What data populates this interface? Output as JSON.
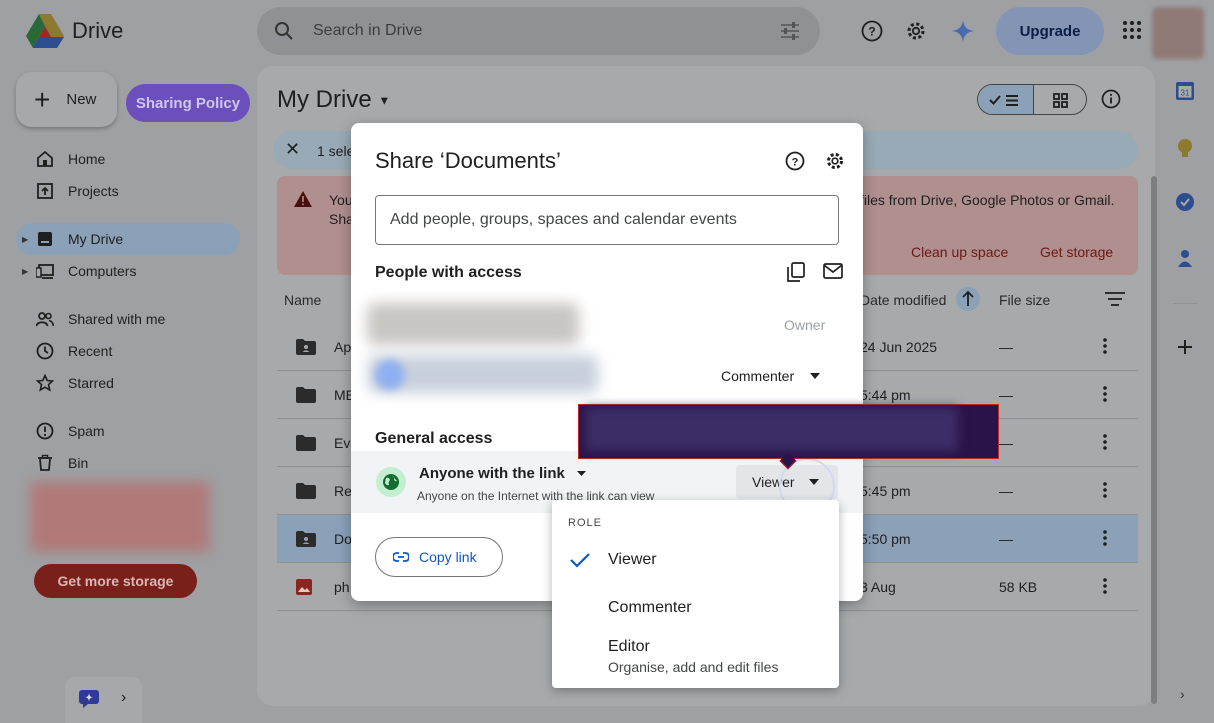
{
  "app": {
    "name": "Drive",
    "upgrade_label": "Upgrade"
  },
  "search": {
    "placeholder": "Search in Drive"
  },
  "sidebar": {
    "new_label": "New",
    "policy_label": "Sharing Policy",
    "items": [
      {
        "label": "Home",
        "icon": "home-icon"
      },
      {
        "label": "Projects",
        "icon": "projects-icon"
      },
      {
        "label": "My Drive",
        "icon": "my-drive-icon"
      },
      {
        "label": "Computers",
        "icon": "computers-icon"
      },
      {
        "label": "Shared with me",
        "icon": "people-icon"
      },
      {
        "label": "Recent",
        "icon": "clock-icon"
      },
      {
        "label": "Starred",
        "icon": "star-icon"
      },
      {
        "label": "Spam",
        "icon": "spam-icon"
      },
      {
        "label": "Bin",
        "icon": "bin-icon"
      }
    ],
    "more_storage_label": "Get more storage"
  },
  "main": {
    "title": "My Drive",
    "selection_text": "1 sele",
    "banner": {
      "line1": "You",
      "line2": "Sha",
      "line3": "files from Drive, Google Photos or Gmail.",
      "cleanup_label": "Clean up space",
      "storage_label": "Get storage"
    },
    "columns": {
      "name": "Name",
      "date": "Date modified",
      "size": "File size"
    },
    "rows": [
      {
        "name": "Ap",
        "date": "24 Jun 2025",
        "size": "—",
        "kind": "shared-folder"
      },
      {
        "name": "ME",
        "date": "5:44 pm",
        "size": "—",
        "kind": "folder"
      },
      {
        "name": "Eva",
        "date": "",
        "size": "—",
        "kind": "folder"
      },
      {
        "name": "Re",
        "date": "5:45 pm",
        "size": "—",
        "kind": "folder"
      },
      {
        "name": "Do",
        "date": "5:50 pm",
        "size": "—",
        "kind": "shared-folder",
        "selected": true
      },
      {
        "name": "ph",
        "date": "3 Aug",
        "size": "58 KB",
        "kind": "image"
      }
    ]
  },
  "dialog": {
    "title": "Share ‘Documents’",
    "add_placeholder": "Add people, groups, spaces and calendar events",
    "people_title": "People with access",
    "owner_label": "Owner",
    "commenter_label": "Commenter",
    "general_title": "General access",
    "link_scope": "Anyone with the link",
    "link_desc": "Anyone on the Internet with the link can view",
    "role_value": "Viewer",
    "copy_link_label": "Copy link"
  },
  "role_menu": {
    "heading": "ROLE",
    "options": [
      {
        "label": "Viewer",
        "selected": true
      },
      {
        "label": "Commenter"
      },
      {
        "label": "Editor",
        "description": "Organise, add and edit files"
      }
    ]
  },
  "colors": {
    "accent": "#0b57d0",
    "policy": "#6b4fbb",
    "storage": "#7b1f1a",
    "tooltip": "#2a1349"
  }
}
